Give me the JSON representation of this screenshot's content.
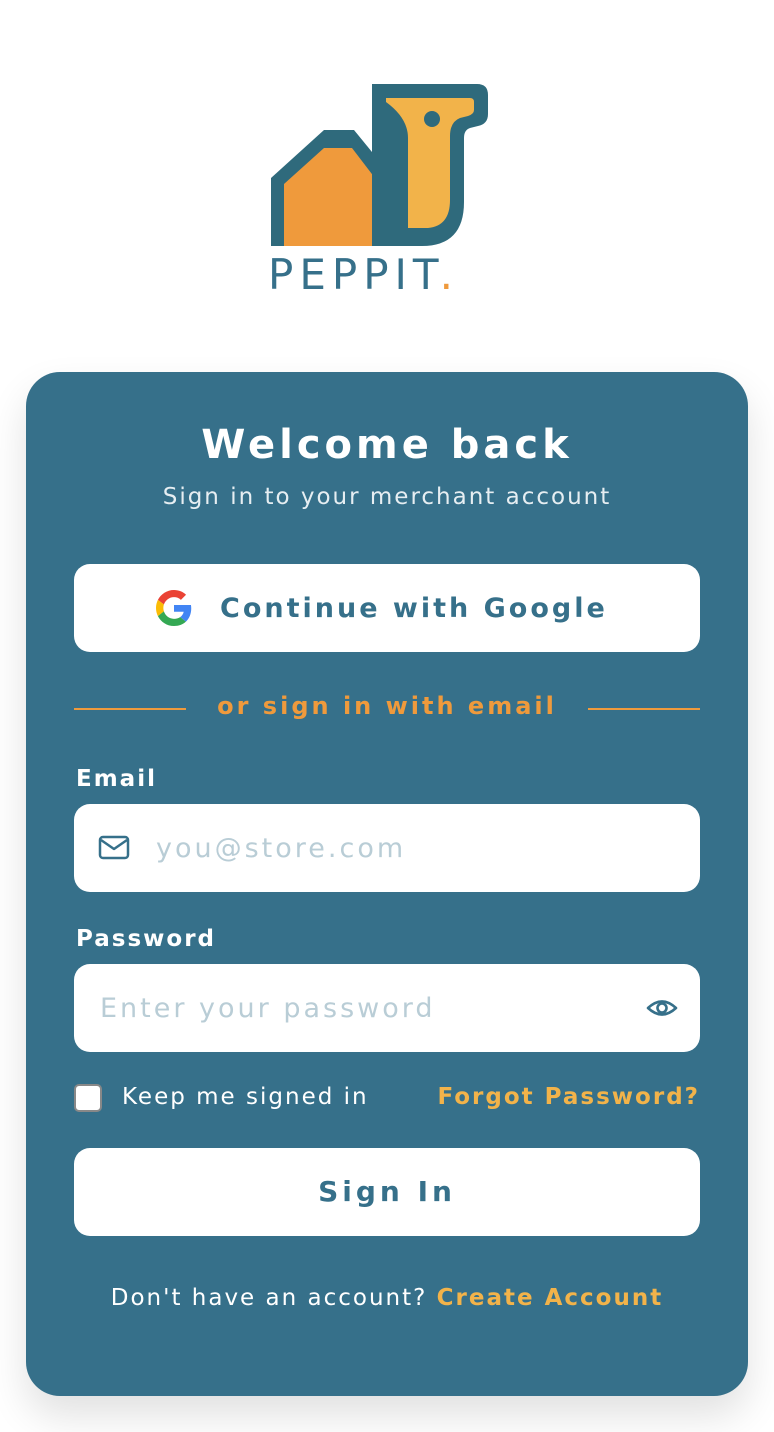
{
  "brand": {
    "name": "PEPPIT",
    "dot": "."
  },
  "colors": {
    "primary": "#36708a",
    "accent_orange": "#ef9a3c",
    "accent_yellow": "#f2b34a",
    "background": "#ffffff"
  },
  "card": {
    "title": "Welcome back",
    "subtitle": "Sign in to your merchant account"
  },
  "google": {
    "label": "Continue with Google",
    "icon": "google-icon"
  },
  "divider": {
    "text": "or sign in with email"
  },
  "email": {
    "label": "Email",
    "placeholder": "you@store.com",
    "value": "",
    "icon": "mail-icon"
  },
  "password": {
    "label": "Password",
    "placeholder": "Enter your password",
    "value": "",
    "icon": "eye-icon"
  },
  "remember": {
    "label": "Keep me signed in",
    "checked": false
  },
  "forgot": {
    "label": "Forgot Password?"
  },
  "signin": {
    "label": "Sign In"
  },
  "footer": {
    "prompt": "Don't have an account?",
    "create_label": "Create Account"
  }
}
